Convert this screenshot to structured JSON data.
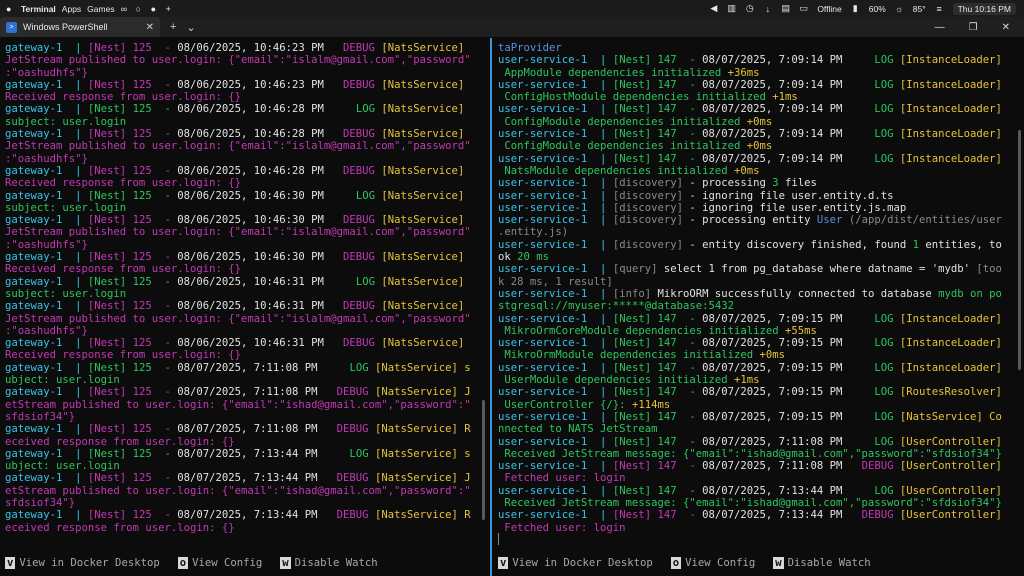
{
  "menubar": {
    "app": "Terminal",
    "apps": "Apps",
    "games": "Games",
    "network": "Offline",
    "battery": "60%",
    "temp": "85°",
    "clock": "Thu 10:16 PM"
  },
  "tab": {
    "title": "Windows PowerShell"
  },
  "left_lines": [
    [
      [
        "gateway-1  | ",
        "cyan"
      ],
      [
        "[Nest] 125  - ",
        "mag"
      ],
      [
        "08/06/2025, 10:46:23 PM   ",
        "white"
      ],
      [
        "DEBUG ",
        "mag"
      ],
      [
        "[NatsService]",
        "yellow"
      ]
    ],
    [
      [
        "JetStream published to user.login: {\"email\":\"islalm@gmail.com\",\"password\"",
        "mag"
      ]
    ],
    [
      [
        ":\"oashudhfs\"}",
        "mag"
      ]
    ],
    [
      [
        "gateway-1  | ",
        "cyan"
      ],
      [
        "[Nest] 125  - ",
        "mag"
      ],
      [
        "08/06/2025, 10:46:23 PM   ",
        "white"
      ],
      [
        "DEBUG ",
        "mag"
      ],
      [
        "[NatsService]",
        "yellow"
      ]
    ],
    [
      [
        "Received response from user.login: {}",
        "mag"
      ]
    ],
    [
      [
        "gateway-1  | ",
        "cyan"
      ],
      [
        "[Nest] 125  - ",
        "green"
      ],
      [
        "08/06/2025, 10:46:28 PM     ",
        "white"
      ],
      [
        "LOG ",
        "green"
      ],
      [
        "[NatsService]",
        "yellow"
      ]
    ],
    [
      [
        "subject: user.login",
        "green"
      ]
    ],
    [
      [
        "gateway-1  | ",
        "cyan"
      ],
      [
        "[Nest] 125  - ",
        "mag"
      ],
      [
        "08/06/2025, 10:46:28 PM   ",
        "white"
      ],
      [
        "DEBUG ",
        "mag"
      ],
      [
        "[NatsService]",
        "yellow"
      ]
    ],
    [
      [
        "JetStream published to user.login: {\"email\":\"islalm@gmail.com\",\"password\"",
        "mag"
      ]
    ],
    [
      [
        ":\"oashudhfs\"}",
        "mag"
      ]
    ],
    [
      [
        "gateway-1  | ",
        "cyan"
      ],
      [
        "[Nest] 125  - ",
        "mag"
      ],
      [
        "08/06/2025, 10:46:28 PM   ",
        "white"
      ],
      [
        "DEBUG ",
        "mag"
      ],
      [
        "[NatsService]",
        "yellow"
      ]
    ],
    [
      [
        "Received response from user.login: {}",
        "mag"
      ]
    ],
    [
      [
        "gateway-1  | ",
        "cyan"
      ],
      [
        "[Nest] 125  - ",
        "green"
      ],
      [
        "08/06/2025, 10:46:30 PM     ",
        "white"
      ],
      [
        "LOG ",
        "green"
      ],
      [
        "[NatsService]",
        "yellow"
      ]
    ],
    [
      [
        "subject: user.login",
        "green"
      ]
    ],
    [
      [
        "gateway-1  | ",
        "cyan"
      ],
      [
        "[Nest] 125  - ",
        "mag"
      ],
      [
        "08/06/2025, 10:46:30 PM   ",
        "white"
      ],
      [
        "DEBUG ",
        "mag"
      ],
      [
        "[NatsService]",
        "yellow"
      ]
    ],
    [
      [
        "JetStream published to user.login: {\"email\":\"islalm@gmail.com\",\"password\"",
        "mag"
      ]
    ],
    [
      [
        ":\"oashudhfs\"}",
        "mag"
      ]
    ],
    [
      [
        "gateway-1  | ",
        "cyan"
      ],
      [
        "[Nest] 125  - ",
        "mag"
      ],
      [
        "08/06/2025, 10:46:30 PM   ",
        "white"
      ],
      [
        "DEBUG ",
        "mag"
      ],
      [
        "[NatsService]",
        "yellow"
      ]
    ],
    [
      [
        "Received response from user.login: {}",
        "mag"
      ]
    ],
    [
      [
        "gateway-1  | ",
        "cyan"
      ],
      [
        "[Nest] 125  - ",
        "green"
      ],
      [
        "08/06/2025, 10:46:31 PM     ",
        "white"
      ],
      [
        "LOG ",
        "green"
      ],
      [
        "[NatsService]",
        "yellow"
      ]
    ],
    [
      [
        "subject: user.login",
        "green"
      ]
    ],
    [
      [
        "gateway-1  | ",
        "cyan"
      ],
      [
        "[Nest] 125  - ",
        "mag"
      ],
      [
        "08/06/2025, 10:46:31 PM   ",
        "white"
      ],
      [
        "DEBUG ",
        "mag"
      ],
      [
        "[NatsService]",
        "yellow"
      ]
    ],
    [
      [
        "JetStream published to user.login: {\"email\":\"islalm@gmail.com\",\"password\"",
        "mag"
      ]
    ],
    [
      [
        ":\"oashudhfs\"}",
        "mag"
      ]
    ],
    [
      [
        "gateway-1  | ",
        "cyan"
      ],
      [
        "[Nest] 125  - ",
        "mag"
      ],
      [
        "08/06/2025, 10:46:31 PM   ",
        "white"
      ],
      [
        "DEBUG ",
        "mag"
      ],
      [
        "[NatsService]",
        "yellow"
      ]
    ],
    [
      [
        "Received response from user.login: {}",
        "mag"
      ]
    ],
    [
      [
        "gateway-1  | ",
        "cyan"
      ],
      [
        "[Nest] 125  - ",
        "green"
      ],
      [
        "08/07/2025, 7:11:08 PM     ",
        "white"
      ],
      [
        "LOG ",
        "green"
      ],
      [
        "[NatsService] s",
        "yellow"
      ]
    ],
    [
      [
        "ubject: user.login",
        "green"
      ]
    ],
    [
      [
        "gateway-1  | ",
        "cyan"
      ],
      [
        "[Nest] 125  - ",
        "mag"
      ],
      [
        "08/07/2025, 7:11:08 PM   ",
        "white"
      ],
      [
        "DEBUG ",
        "mag"
      ],
      [
        "[NatsService] J",
        "yellow"
      ]
    ],
    [
      [
        "etStream published to user.login: {\"email\":\"ishad@gmail.com\",\"password\":\"",
        "mag"
      ]
    ],
    [
      [
        "sfdsiof34\"}",
        "mag"
      ]
    ],
    [
      [
        "gateway-1  | ",
        "cyan"
      ],
      [
        "[Nest] 125  - ",
        "mag"
      ],
      [
        "08/07/2025, 7:11:08 PM   ",
        "white"
      ],
      [
        "DEBUG ",
        "mag"
      ],
      [
        "[NatsService] R",
        "yellow"
      ]
    ],
    [
      [
        "eceived response from user.login: {}",
        "mag"
      ]
    ],
    [
      [
        "gateway-1  | ",
        "cyan"
      ],
      [
        "[Nest] 125  - ",
        "green"
      ],
      [
        "08/07/2025, 7:13:44 PM     ",
        "white"
      ],
      [
        "LOG ",
        "green"
      ],
      [
        "[NatsService] s",
        "yellow"
      ]
    ],
    [
      [
        "ubject: user.login",
        "green"
      ]
    ],
    [
      [
        "gateway-1  | ",
        "cyan"
      ],
      [
        "[Nest] 125  - ",
        "mag"
      ],
      [
        "08/07/2025, 7:13:44 PM   ",
        "white"
      ],
      [
        "DEBUG ",
        "mag"
      ],
      [
        "[NatsService] J",
        "yellow"
      ]
    ],
    [
      [
        "etStream published to user.login: {\"email\":\"ishad@gmail.com\",\"password\":\"",
        "mag"
      ]
    ],
    [
      [
        "sfdsiof34\"}",
        "mag"
      ]
    ],
    [
      [
        "gateway-1  | ",
        "cyan"
      ],
      [
        "[Nest] 125  - ",
        "mag"
      ],
      [
        "08/07/2025, 7:13:44 PM   ",
        "white"
      ],
      [
        "DEBUG ",
        "mag"
      ],
      [
        "[NatsService] R",
        "yellow"
      ]
    ],
    [
      [
        "eceived response from user.login: {}",
        "mag"
      ]
    ]
  ],
  "right_lines": [
    [
      [
        "taProvider",
        "blue"
      ]
    ],
    [
      [
        "user-service-1  | ",
        "cyan"
      ],
      [
        "[Nest] 147  - ",
        "green"
      ],
      [
        "08/07/2025, 7:09:14 PM     ",
        "white"
      ],
      [
        "LOG ",
        "green"
      ],
      [
        "[InstanceLoader]",
        "yellow"
      ]
    ],
    [
      [
        " AppModule dependencies initialized ",
        "green"
      ],
      [
        "+36ms",
        "yellow"
      ]
    ],
    [
      [
        "user-service-1  | ",
        "cyan"
      ],
      [
        "[Nest] 147  - ",
        "green"
      ],
      [
        "08/07/2025, 7:09:14 PM     ",
        "white"
      ],
      [
        "LOG ",
        "green"
      ],
      [
        "[InstanceLoader]",
        "yellow"
      ]
    ],
    [
      [
        " ConfigHostModule dependencies initialized ",
        "green"
      ],
      [
        "+1ms",
        "yellow"
      ]
    ],
    [
      [
        "user-service-1  | ",
        "cyan"
      ],
      [
        "[Nest] 147  - ",
        "green"
      ],
      [
        "08/07/2025, 7:09:14 PM     ",
        "white"
      ],
      [
        "LOG ",
        "green"
      ],
      [
        "[InstanceLoader]",
        "yellow"
      ]
    ],
    [
      [
        " ConfigModule dependencies initialized ",
        "green"
      ],
      [
        "+0ms",
        "yellow"
      ]
    ],
    [
      [
        "user-service-1  | ",
        "cyan"
      ],
      [
        "[Nest] 147  - ",
        "green"
      ],
      [
        "08/07/2025, 7:09:14 PM     ",
        "white"
      ],
      [
        "LOG ",
        "green"
      ],
      [
        "[InstanceLoader]",
        "yellow"
      ]
    ],
    [
      [
        " ConfigModule dependencies initialized ",
        "green"
      ],
      [
        "+0ms",
        "yellow"
      ]
    ],
    [
      [
        "user-service-1  | ",
        "cyan"
      ],
      [
        "[Nest] 147  - ",
        "green"
      ],
      [
        "08/07/2025, 7:09:14 PM     ",
        "white"
      ],
      [
        "LOG ",
        "green"
      ],
      [
        "[InstanceLoader]",
        "yellow"
      ]
    ],
    [
      [
        " NatsModule dependencies initialized ",
        "green"
      ],
      [
        "+0ms",
        "yellow"
      ]
    ],
    [
      [
        "user-service-1  | ",
        "cyan"
      ],
      [
        "[discovery] ",
        "gray"
      ],
      [
        "- processing ",
        "white"
      ],
      [
        "3",
        "green"
      ],
      [
        " files",
        "white"
      ]
    ],
    [
      [
        "user-service-1  | ",
        "cyan"
      ],
      [
        "[discovery] ",
        "gray"
      ],
      [
        "- ignoring file user.entity.d.ts",
        "white"
      ]
    ],
    [
      [
        "user-service-1  | ",
        "cyan"
      ],
      [
        "[discovery] ",
        "gray"
      ],
      [
        "- ignoring file user.entity.js.map",
        "white"
      ]
    ],
    [
      [
        "user-service-1  | ",
        "cyan"
      ],
      [
        "[discovery] ",
        "gray"
      ],
      [
        "- processing entity ",
        "white"
      ],
      [
        "User",
        "blue"
      ],
      [
        " (/app/dist/entities/user",
        "gray"
      ]
    ],
    [
      [
        ".entity.js)",
        "gray"
      ]
    ],
    [
      [
        "user-service-1  | ",
        "cyan"
      ],
      [
        "[discovery] ",
        "gray"
      ],
      [
        "- entity discovery finished, found ",
        "white"
      ],
      [
        "1",
        "green"
      ],
      [
        " entities, to",
        "white"
      ]
    ],
    [
      [
        "ok ",
        "white"
      ],
      [
        "20 ms",
        "green"
      ]
    ],
    [
      [
        "user-service-1  | ",
        "cyan"
      ],
      [
        "[query] ",
        "gray"
      ],
      [
        "select 1 from pg_database where datname = 'mydb' ",
        "white"
      ],
      [
        "[too",
        "gray"
      ]
    ],
    [
      [
        "k 28 ms, 1 result]",
        "gray"
      ]
    ],
    [
      [
        "user-service-1  | ",
        "cyan"
      ],
      [
        "[info] ",
        "gray"
      ],
      [
        "MikroORM successfully connected to database ",
        "white"
      ],
      [
        "mydb on po",
        "green"
      ]
    ],
    [
      [
        "stgresql://myuser:*****@database:5432",
        "green"
      ]
    ],
    [
      [
        "user-service-1  | ",
        "cyan"
      ],
      [
        "[Nest] 147  - ",
        "green"
      ],
      [
        "08/07/2025, 7:09:15 PM     ",
        "white"
      ],
      [
        "LOG ",
        "green"
      ],
      [
        "[InstanceLoader]",
        "yellow"
      ]
    ],
    [
      [
        " MikroOrmCoreModule dependencies initialized ",
        "green"
      ],
      [
        "+55ms",
        "yellow"
      ]
    ],
    [
      [
        "user-service-1  | ",
        "cyan"
      ],
      [
        "[Nest] 147  - ",
        "green"
      ],
      [
        "08/07/2025, 7:09:15 PM     ",
        "white"
      ],
      [
        "LOG ",
        "green"
      ],
      [
        "[InstanceLoader]",
        "yellow"
      ]
    ],
    [
      [
        " MikroOrmModule dependencies initialized ",
        "green"
      ],
      [
        "+0ms",
        "yellow"
      ]
    ],
    [
      [
        "user-service-1  | ",
        "cyan"
      ],
      [
        "[Nest] 147  - ",
        "green"
      ],
      [
        "08/07/2025, 7:09:15 PM     ",
        "white"
      ],
      [
        "LOG ",
        "green"
      ],
      [
        "[InstanceLoader]",
        "yellow"
      ]
    ],
    [
      [
        " UserModule dependencies initialized ",
        "green"
      ],
      [
        "+1ms",
        "yellow"
      ]
    ],
    [
      [
        "user-service-1  | ",
        "cyan"
      ],
      [
        "[Nest] 147  - ",
        "green"
      ],
      [
        "08/07/2025, 7:09:15 PM     ",
        "white"
      ],
      [
        "LOG ",
        "green"
      ],
      [
        "[RoutesResolver]",
        "yellow"
      ]
    ],
    [
      [
        " UserController {/}: ",
        "green"
      ],
      [
        "+114ms",
        "yellow"
      ]
    ],
    [
      [
        "user-service-1  | ",
        "cyan"
      ],
      [
        "[Nest] 147  - ",
        "green"
      ],
      [
        "08/07/2025, 7:09:15 PM     ",
        "white"
      ],
      [
        "LOG ",
        "green"
      ],
      [
        "[NatsService] Co",
        "yellow"
      ]
    ],
    [
      [
        "nnected to NATS JetStream",
        "green"
      ]
    ],
    [
      [
        "user-service-1  | ",
        "cyan"
      ],
      [
        "[Nest] 147  - ",
        "green"
      ],
      [
        "08/07/2025, 7:11:08 PM     ",
        "white"
      ],
      [
        "LOG ",
        "green"
      ],
      [
        "[UserController]",
        "yellow"
      ]
    ],
    [
      [
        " Received JetStream message: {\"email\":\"ishad@gmail.com\",\"password\":\"sfdsiof34\"}",
        "green"
      ]
    ],
    [
      [
        "user-service-1  | ",
        "cyan"
      ],
      [
        "[Nest] 147  - ",
        "mag"
      ],
      [
        "08/07/2025, 7:11:08 PM   ",
        "white"
      ],
      [
        "DEBUG ",
        "mag"
      ],
      [
        "[UserController]",
        "yellow"
      ]
    ],
    [
      [
        " Fetched user: login",
        "mag"
      ]
    ],
    [
      [
        "user-service-1  | ",
        "cyan"
      ],
      [
        "[Nest] 147  - ",
        "green"
      ],
      [
        "08/07/2025, 7:13:44 PM     ",
        "white"
      ],
      [
        "LOG ",
        "green"
      ],
      [
        "[UserController]",
        "yellow"
      ]
    ],
    [
      [
        " Received JetStream message: {\"email\":\"ishad@gmail.com\",\"password\":\"sfdsiof34\"}",
        "green"
      ]
    ],
    [
      [
        "user-service-1  | ",
        "cyan"
      ],
      [
        "[Nest] 147  - ",
        "mag"
      ],
      [
        "08/07/2025, 7:13:44 PM   ",
        "white"
      ],
      [
        "DEBUG ",
        "mag"
      ],
      [
        "[UserController]",
        "yellow"
      ]
    ],
    [
      [
        " Fetched user: login",
        "mag"
      ]
    ]
  ],
  "footer": {
    "items": [
      {
        "key": "v",
        "label": "View in Docker Desktop"
      },
      {
        "key": "o",
        "label": "View Config"
      },
      {
        "key": "w",
        "label": "Disable Watch"
      }
    ]
  },
  "colors": {
    "cyan": "#3bc2e6",
    "green": "#2dc55e",
    "yellow": "#e5c43b",
    "mag": "#c239b3",
    "white": "#e2e2e2",
    "gray": "#8a8a8a",
    "blue": "#5d8fe0",
    "divider": "#3a96dd"
  }
}
